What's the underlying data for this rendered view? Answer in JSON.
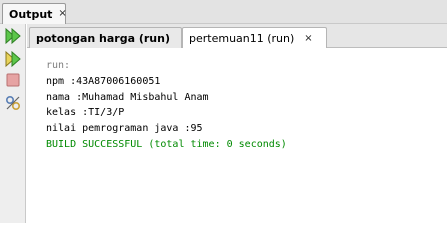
{
  "window": {
    "title": "Output",
    "close_glyph": "×"
  },
  "toolbar": {
    "icons": [
      "rerun-icon",
      "rerun-with-options-icon",
      "stop-icon",
      "settings-icon"
    ]
  },
  "tabs": [
    {
      "label": "potongan harga (run)",
      "close_glyph": "×",
      "active": false
    },
    {
      "label": "pertemuan11 (run)",
      "close_glyph": "×",
      "active": true
    }
  ],
  "console": {
    "lines": [
      {
        "text": "run:",
        "style": "muted"
      },
      {
        "text": "npm :43A87006160051",
        "style": "normal"
      },
      {
        "text": "nama :Muhamad Misbahul Anam",
        "style": "normal"
      },
      {
        "text": "kelas :TI/3/P",
        "style": "normal"
      },
      {
        "text": "nilai pemrograman java :95",
        "style": "normal"
      },
      {
        "text": "BUILD SUCCESSFUL (total time: 0 seconds)",
        "style": "success"
      }
    ]
  },
  "colors": {
    "success": "#008a00",
    "muted": "#808080",
    "rerun_green": "#3aa62e",
    "stop_red": "#d36f6f"
  }
}
